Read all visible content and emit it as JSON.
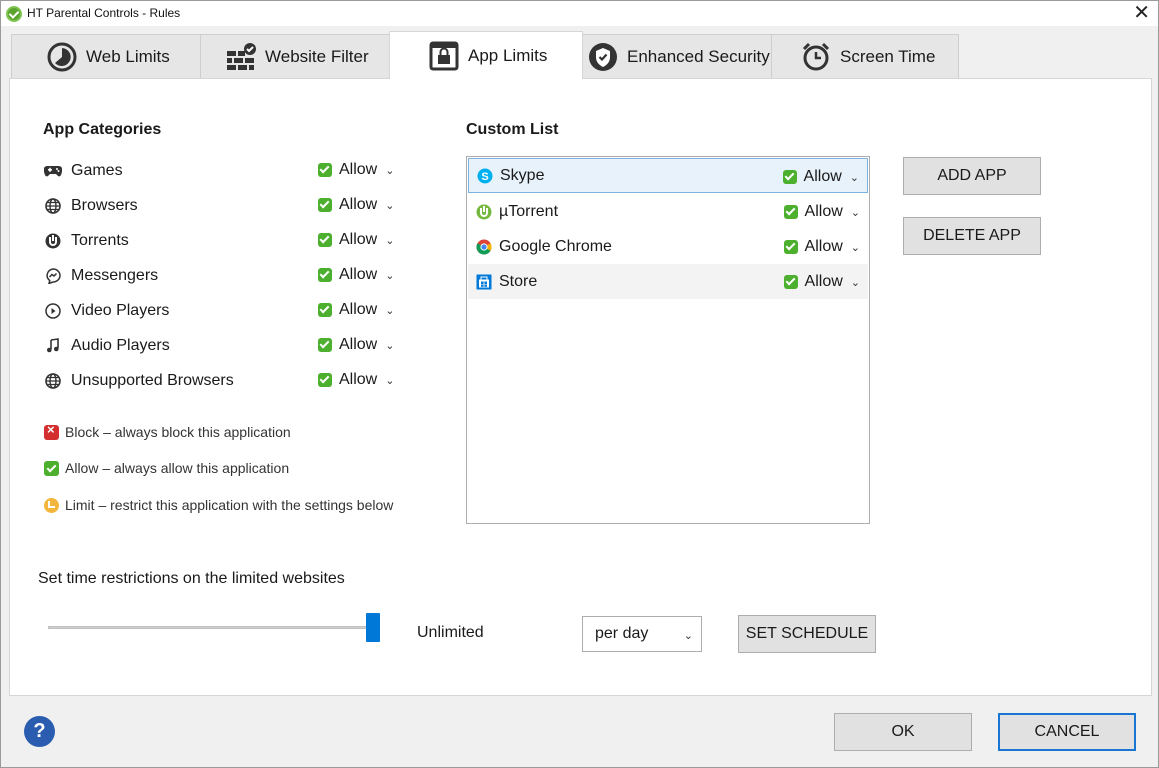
{
  "window": {
    "title": "HT Parental Controls - Rules"
  },
  "tabs": [
    {
      "label": "Web Limits",
      "icon": "pie-clock-icon"
    },
    {
      "label": "Website Filter",
      "icon": "brick-wall-check-icon"
    },
    {
      "label": "App Limits",
      "icon": "lock-window-icon"
    },
    {
      "label": "Enhanced Security",
      "icon": "shield-check-icon"
    },
    {
      "label": "Screen Time",
      "icon": "alarm-clock-icon"
    }
  ],
  "active_tab": "App Limits",
  "app_categories": {
    "heading": "App Categories",
    "items": [
      {
        "label": "Games",
        "icon": "gamepad-icon",
        "value": "Allow"
      },
      {
        "label": "Browsers",
        "icon": "globe-icon",
        "value": "Allow"
      },
      {
        "label": "Torrents",
        "icon": "torrent-icon",
        "value": "Allow"
      },
      {
        "label": "Messengers",
        "icon": "messenger-icon",
        "value": "Allow"
      },
      {
        "label": "Video Players",
        "icon": "play-circle-icon",
        "value": "Allow"
      },
      {
        "label": "Audio Players",
        "icon": "music-note-icon",
        "value": "Allow"
      },
      {
        "label": "Unsupported Browsers",
        "icon": "globe-icon",
        "value": "Allow"
      }
    ]
  },
  "legend": {
    "block": "Block – always block this application",
    "allow": "Allow – always allow this application",
    "limit": "Limit – restrict this application with the settings below"
  },
  "custom_list": {
    "heading": "Custom List",
    "items": [
      {
        "label": "Skype",
        "icon": "skype-icon",
        "value": "Allow"
      },
      {
        "label": "µTorrent",
        "icon": "utorrent-icon",
        "value": "Allow"
      },
      {
        "label": "Google Chrome",
        "icon": "chrome-icon",
        "value": "Allow"
      },
      {
        "label": "Store",
        "icon": "store-icon",
        "value": "Allow"
      }
    ]
  },
  "buttons": {
    "add_app": "ADD APP",
    "delete_app": "DELETE APP",
    "set_schedule": "SET SCHEDULE",
    "ok": "OK",
    "cancel": "CANCEL",
    "help": "?"
  },
  "time_restrictions": {
    "label": "Set time restrictions on the limited websites",
    "slider_value_text": "Unlimited",
    "slider_fraction": 1.0,
    "period": "per day"
  },
  "colors": {
    "allow_green": "#4caf2e",
    "block_red": "#d32f2f",
    "limit_yellow": "#f2b63c",
    "accent_blue": "#0078d7"
  }
}
